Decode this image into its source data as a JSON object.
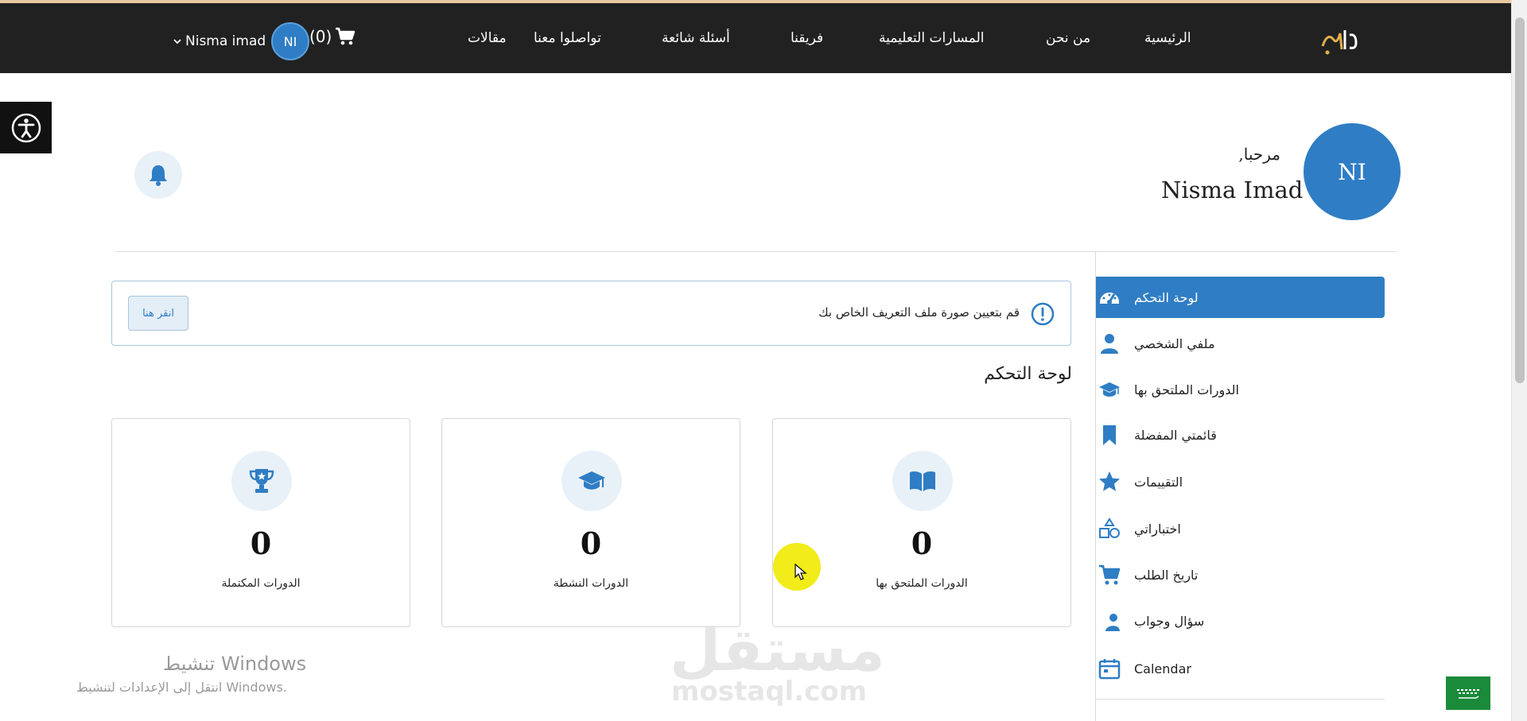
{
  "nav": {
    "links": [
      {
        "label": "الرئيسية"
      },
      {
        "label": "من نحن"
      },
      {
        "label": "المسارات التعليمية"
      },
      {
        "label": "فريقنا"
      },
      {
        "label": "أسئلة شائعة"
      },
      {
        "label": "تواصلوا معنا"
      },
      {
        "label": "مقالات"
      }
    ],
    "cart_count": "(0)",
    "avatar_initials": "NI",
    "user_name": "Nisma imad"
  },
  "profile": {
    "initials": "NI",
    "welcome": "مرحبا,",
    "name": "Nisma Imad"
  },
  "alert": {
    "message": "قم بتعيين صورة ملف التعريف الخاص بك",
    "button": "انقر هنا"
  },
  "dashboard_title": "لوحة التحكم",
  "sidebar": {
    "items": [
      {
        "label": "لوحة التحكم",
        "icon": "dashboard-icon",
        "active": true
      },
      {
        "label": "ملفي الشخصي",
        "icon": "user-icon"
      },
      {
        "label": "الدورات الملتحق بها",
        "icon": "graduation-cap-icon"
      },
      {
        "label": "قائمتي المفضلة",
        "icon": "bookmark-icon"
      },
      {
        "label": "التقييمات",
        "icon": "star-icon"
      },
      {
        "label": "اختباراتي",
        "icon": "shapes-icon"
      },
      {
        "label": "تاريخ الطلب",
        "icon": "cart-icon"
      },
      {
        "label": "سؤال وجواب",
        "icon": "question-person-icon"
      },
      {
        "label": "Calendar",
        "icon": "calendar-icon"
      }
    ]
  },
  "stats": [
    {
      "value": "0",
      "label": "الدورات الملتحق بها",
      "icon": "open-book-icon"
    },
    {
      "value": "0",
      "label": "الدورات النشطة",
      "icon": "graduation-cap-icon"
    },
    {
      "value": "0",
      "label": "الدورات المكتملة",
      "icon": "trophy-icon"
    }
  ],
  "windows": {
    "title": "تنشيط Windows",
    "subtitle": "انتقل إلى الإعدادات لتنشيط Windows."
  },
  "watermark": {
    "arabic": "مستقل",
    "latin": "mostaql.com"
  },
  "colors": {
    "accent": "#2f7dc4",
    "navbar": "#212121",
    "icon_bg": "#e9f1f8"
  }
}
